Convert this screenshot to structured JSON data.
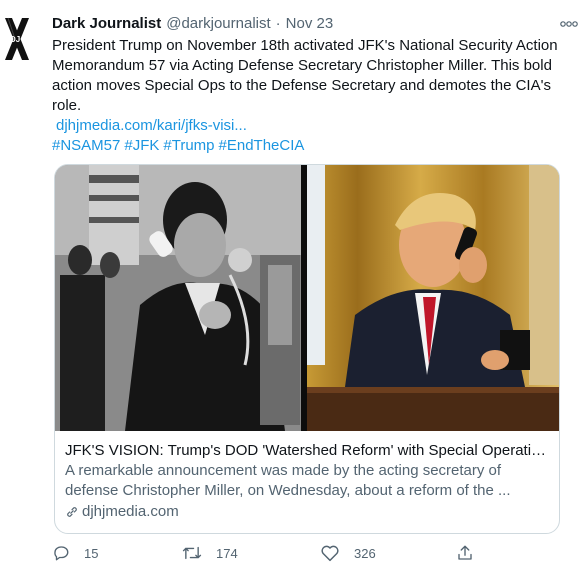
{
  "tweet": {
    "display_name": "Dark Journalist",
    "handle": "@darkjournalist",
    "separator": "·",
    "time": "Nov 23",
    "avatar_text": "DJ",
    "more_label": "ooo",
    "text": "President Trump on November 18th activated JFK's National Security Action Memorandum 57 via Acting Defense Secretary Christopher Miller. This bold action moves Special Ops to the Defense Secretary and demotes the CIA's role.",
    "link": "djhjmedia.com/kari/jfks-visi...",
    "hashtags": [
      "#NSAM57",
      "#JFK",
      "#Trump",
      "#EndTheCIA"
    ]
  },
  "card": {
    "title": "JFK'S VISION: Trump's DOD 'Watershed Reform' with Special Operations ...",
    "description": "A remarkable announcement was made by the acting secretary of defense Christopher Miller, on Wednesday, about a reform of the ...",
    "domain": "djhjmedia.com"
  },
  "actions": {
    "replies": "15",
    "retweets": "174",
    "likes": "326"
  },
  "colors": {
    "link": "#1b95e0",
    "secondary": "#536471",
    "border": "#cfd9de"
  }
}
